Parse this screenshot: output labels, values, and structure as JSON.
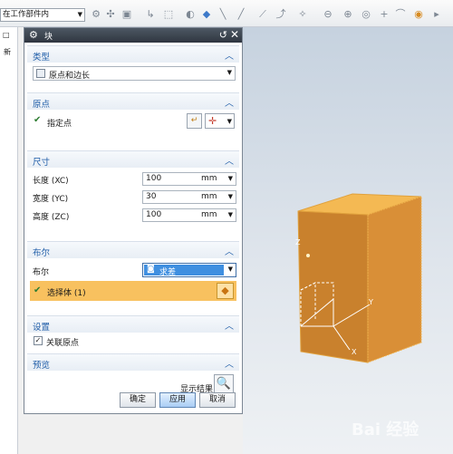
{
  "toolbar": {
    "scope_value": "在工作部件内",
    "icons": [
      "snap-icon",
      "filter-icon",
      "select-icon",
      "point-icon",
      "box-select-icon",
      "view-icon",
      "cube-icon",
      "line-icon",
      "line-icon",
      "line-icon",
      "circle-icon",
      "target-icon",
      "plus-icon",
      "arc-icon",
      "globe-icon"
    ]
  },
  "left_strip": {
    "btn_label": "新"
  },
  "dialog": {
    "title": "块",
    "sections": {
      "type": {
        "header": "类型",
        "selected": "原点和边长"
      },
      "origin": {
        "header": "原点",
        "specify_point": "指定点"
      },
      "dimensions": {
        "header": "尺寸",
        "rows": [
          {
            "label": "长度 (XC)",
            "value": "100",
            "unit": "mm"
          },
          {
            "label": "宽度 (YC)",
            "value": "30",
            "unit": "mm"
          },
          {
            "label": "高度 (ZC)",
            "value": "100",
            "unit": "mm"
          }
        ]
      },
      "boolean": {
        "header": "布尔",
        "label": "布尔",
        "selected": "求差",
        "select_body": "选择体 (1)"
      },
      "settings": {
        "header": "设置",
        "associative_origin": "关联原点",
        "associative_checked": true
      },
      "preview": {
        "header": "预览",
        "show_result": "显示结果"
      }
    },
    "buttons": {
      "ok": "确定",
      "apply": "应用",
      "cancel": "取消"
    }
  },
  "viewport": {
    "axis_labels": {
      "z": "Z",
      "y": "Y",
      "x": "X"
    }
  },
  "colors": {
    "accent_blue": "#1f5da8",
    "highlight_orange": "#f8c15f",
    "block_front": "#c9812d",
    "block_top": "#f4b953",
    "block_side": "#d98f37",
    "dropdown_selected": "#3f8fe0"
  },
  "watermark": "Bai 经验"
}
